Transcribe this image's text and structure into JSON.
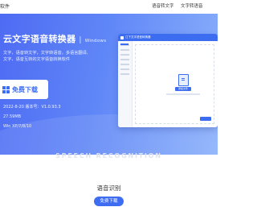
{
  "header": {
    "brand_fragment": "软件",
    "nav": [
      "语音转文字",
      "文字转语音"
    ]
  },
  "hero": {
    "title": "云文字语音转换器",
    "title_sub": "Windows",
    "desc_line1": "文字，语音转文字，文字转语音，多语言翻译,",
    "desc_line2": "文字，语音互转的文字语音转换软件",
    "download_label": "免费下载",
    "meta_line1": "2022-8-20 版本号：V1.0.93.3",
    "meta_line2": "27.59MB",
    "meta_line3": "Win XP/7/8/10"
  },
  "app_mock": {
    "title": "江下文字语音转换器",
    "add_label": "添加文件"
  },
  "section": {
    "watermark": "SPEECH RECOGNITION",
    "title": "语音识别",
    "button_label": "免费下载"
  },
  "colors": {
    "brand_blue": "#3f6df2",
    "hero_start": "#4e6bf3",
    "hero_end": "#8ab0fb"
  }
}
